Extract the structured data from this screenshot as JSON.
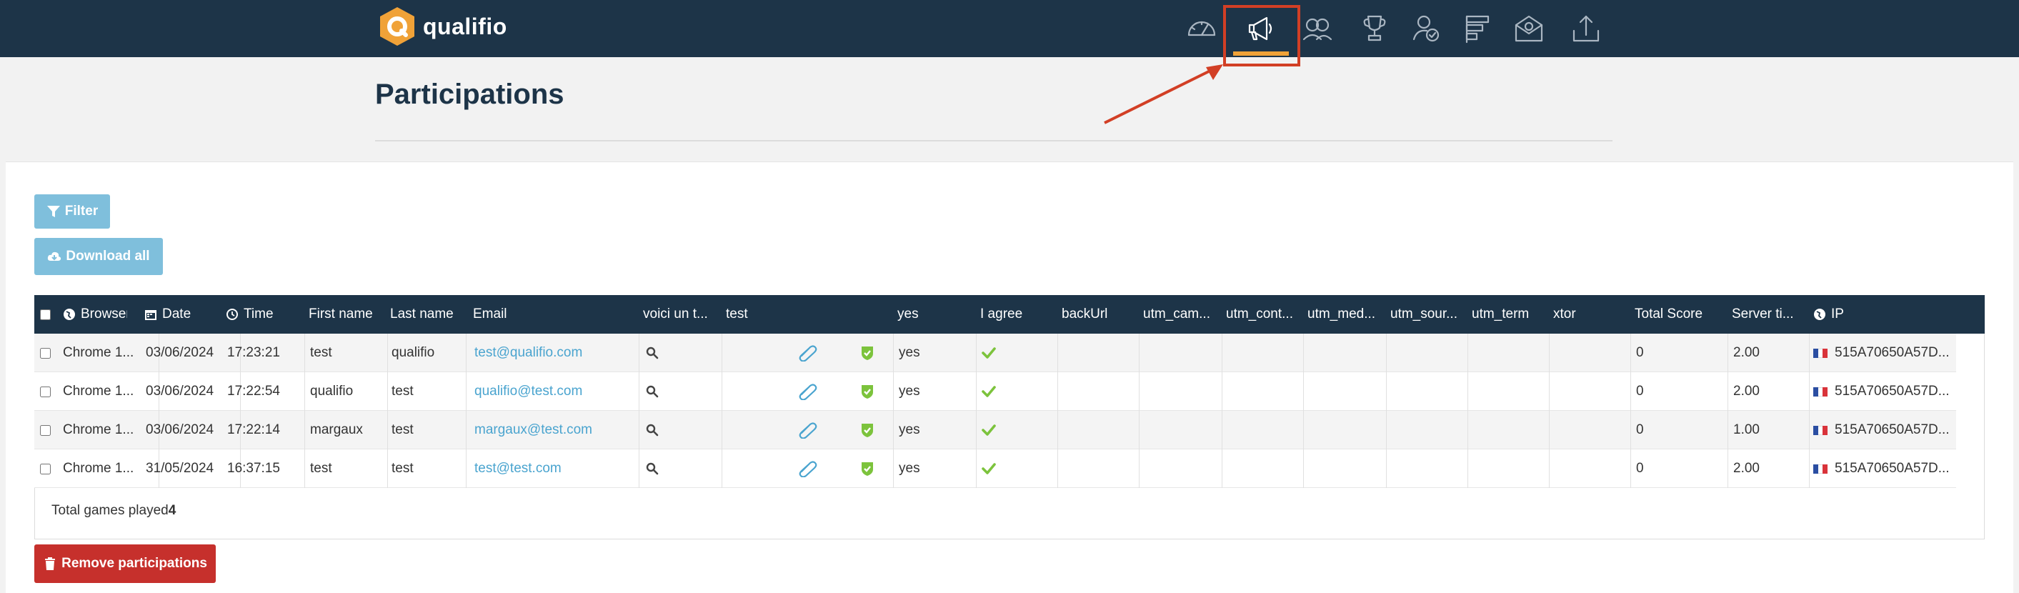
{
  "app": {
    "brand": "qualifio"
  },
  "nav": {
    "icons": [
      "dashboard-icon",
      "campaigns-megaphone-icon",
      "audience-icon",
      "trophy-icon",
      "user-check-icon",
      "layout-icon",
      "mail-icon",
      "upload-icon"
    ],
    "active": "campaigns-megaphone-icon"
  },
  "page": {
    "title": "Participations"
  },
  "buttons": {
    "filter": "Filter",
    "download_all": "Download all",
    "remove_participations": "Remove participations"
  },
  "table": {
    "columns": [
      "Browser",
      "Date",
      "Time",
      "First name",
      "Last name",
      "Email",
      "voici un t...",
      "test",
      "yes",
      "I agree",
      "backUrl",
      "utm_cam...",
      "utm_cont...",
      "utm_med...",
      "utm_sour...",
      "utm_term",
      "xtor",
      "Total Score",
      "Server ti...",
      "IP"
    ],
    "rows": [
      {
        "browser": "Chrome 1...",
        "date": "03/06/2024",
        "time": "17:23:21",
        "first_name": "test",
        "last_name": "qualifio",
        "email": "test@qualifio.com",
        "yes": "yes",
        "total_score": "0",
        "server_time": "2.00",
        "ip": "515A70650A57D..."
      },
      {
        "browser": "Chrome 1...",
        "date": "03/06/2024",
        "time": "17:22:54",
        "first_name": "qualifio",
        "last_name": "test",
        "email": "qualifio@test.com",
        "yes": "yes",
        "total_score": "0",
        "server_time": "2.00",
        "ip": "515A70650A57D..."
      },
      {
        "browser": "Chrome 1...",
        "date": "03/06/2024",
        "time": "17:22:14",
        "first_name": "margaux",
        "last_name": "test",
        "email": "margaux@test.com",
        "yes": "yes",
        "total_score": "0",
        "server_time": "1.00",
        "ip": "515A70650A57D..."
      },
      {
        "browser": "Chrome 1...",
        "date": "31/05/2024",
        "time": "16:37:15",
        "first_name": "test",
        "last_name": "test",
        "email": "test@test.com",
        "yes": "yes",
        "total_score": "0",
        "server_time": "2.00",
        "ip": "515A70650A57D..."
      }
    ],
    "footer": {
      "label": "Total games played",
      "count": "4"
    }
  },
  "colors": {
    "topbar": "#1d3448",
    "accent": "#f0a238",
    "link": "#4aa4cf",
    "button_primary": "#7fbfdc",
    "button_danger": "#c6302c",
    "annotation": "#d23f25"
  }
}
